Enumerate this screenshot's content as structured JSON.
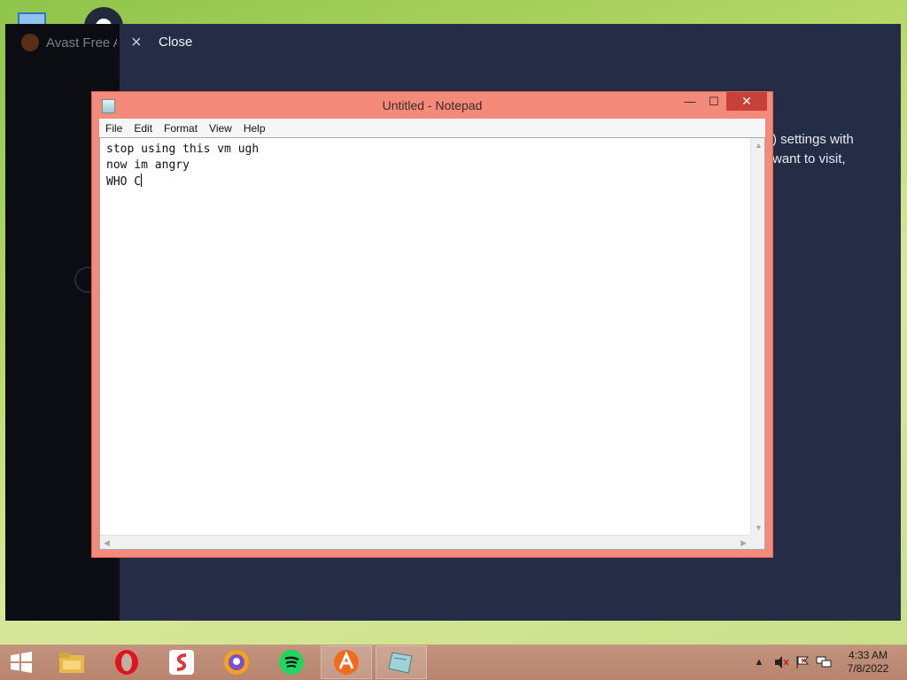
{
  "avast": {
    "app_title": "Avast Free Antivirus",
    "close_label": "Close",
    "body_line1": ") settings with",
    "body_line2": "want to visit,"
  },
  "notepad": {
    "title": "Untitled - Notepad",
    "menu": [
      "File",
      "Edit",
      "Format",
      "View",
      "Help"
    ],
    "lines": [
      "stop using this vm ugh",
      "now im angry",
      "WHO C"
    ],
    "close_glyph": "✕",
    "minimize_glyph": "—",
    "maximize_glyph": "☐"
  },
  "taskbar": {
    "items": [
      {
        "name": "file-explorer",
        "color": "#e9b84a"
      },
      {
        "name": "opera",
        "color": "#e0141e"
      },
      {
        "name": "office-app",
        "color": "#e0373e"
      },
      {
        "name": "avast-secure-browser",
        "color": "#f2a31b"
      },
      {
        "name": "spotify",
        "color": "#1ed760"
      },
      {
        "name": "avast",
        "color": "#f26a1b"
      },
      {
        "name": "notepad",
        "color": "#9fd3d9"
      }
    ],
    "clock_time": "4:33 AM",
    "clock_date": "7/8/2022"
  }
}
